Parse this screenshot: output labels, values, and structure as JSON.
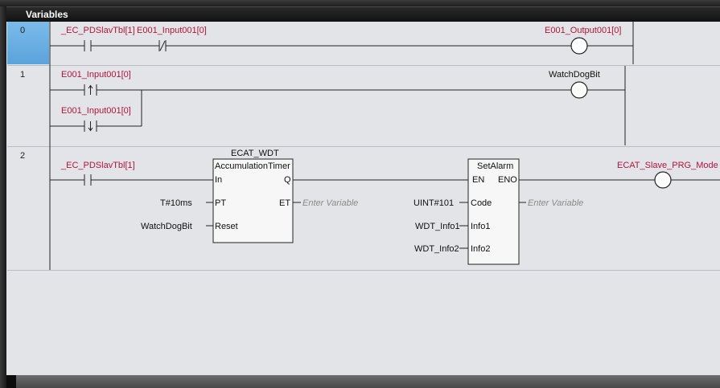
{
  "panel": {
    "title": "Variables"
  },
  "rungs": [
    {
      "number": "0",
      "contacts": [
        "_EC_PDSlavTbl[1]",
        "E001_Input001[0]"
      ],
      "coil": "E001_Output001[0]"
    },
    {
      "number": "1",
      "contacts": [
        "E001_Input001[0]",
        "E001_Input001[0]"
      ],
      "coil": "WatchDogBit"
    },
    {
      "number": "2",
      "contact": "_EC_PDSlavTbl[1]",
      "timer_block": {
        "instance": "ECAT_WDT",
        "type": "AccumulationTimer",
        "pins": {
          "in": "In",
          "q": "Q",
          "pt": "PT",
          "et": "ET",
          "reset": "Reset"
        },
        "inputs": {
          "pt": "T#10ms",
          "reset": "WatchDogBit"
        },
        "et_output": "Enter Variable"
      },
      "alarm_block": {
        "type": "SetAlarm",
        "pins": {
          "en": "EN",
          "eno": "ENO",
          "code": "Code",
          "info1": "Info1",
          "info2": "Info2"
        },
        "inputs": {
          "code": "UINT#101",
          "info1": "WDT_Info1",
          "info2": "WDT_Info2"
        },
        "code_output": "Enter Variable"
      },
      "coil": "ECAT_Slave_PRG_Mode"
    }
  ]
}
